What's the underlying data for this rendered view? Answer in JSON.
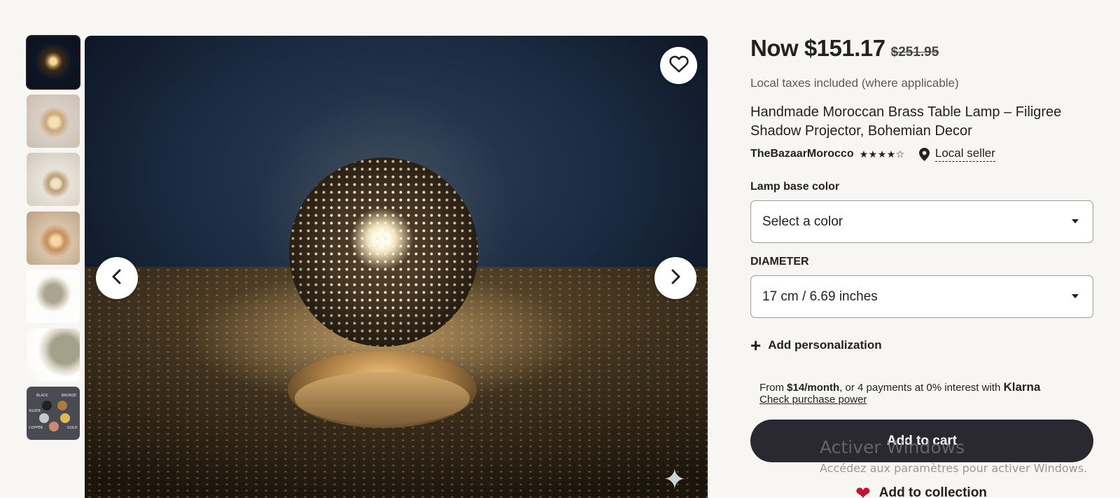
{
  "gallery": {
    "thumbnails": [
      "thumb-1",
      "thumb-2",
      "thumb-3",
      "thumb-4",
      "thumb-5",
      "thumb-6",
      "thumb-7"
    ],
    "active_index": 0,
    "swatch_labels": [
      "BLACK",
      "BRONZE",
      "SILVER",
      "COPPER",
      "GOLD"
    ]
  },
  "product": {
    "price_now": "Now $151.17",
    "price_old": "$251.95",
    "taxes_note": "Local taxes included (where applicable)",
    "title": "Handmade Moroccan Brass Table Lamp – Filigree Shadow Projector, Bohemian Decor",
    "seller": "TheBazaarMorocco",
    "stars": "★★★★☆",
    "local_seller": "Local seller"
  },
  "options": {
    "color_label": "Lamp base color",
    "color_value": "Select a color",
    "diameter_label": "DIAMETER",
    "diameter_value": "17 cm / 6.69 inches",
    "add_personalization": "Add personalization"
  },
  "financing": {
    "prefix": "From ",
    "amount": "$14/month",
    "suffix": ", or 4 payments at 0% interest with ",
    "brand": "Klarna",
    "link": "Check purchase power"
  },
  "actions": {
    "add_to_cart": "Add to cart",
    "add_to_collection": "Add to collection"
  },
  "watermark": {
    "line1": "Activer Windows",
    "line2": "Accédez aux paramètres pour activer Windows."
  },
  "colors": {
    "background": "#f8f6f2",
    "cart_button": "#2a2830",
    "heart": "#c4122f"
  }
}
